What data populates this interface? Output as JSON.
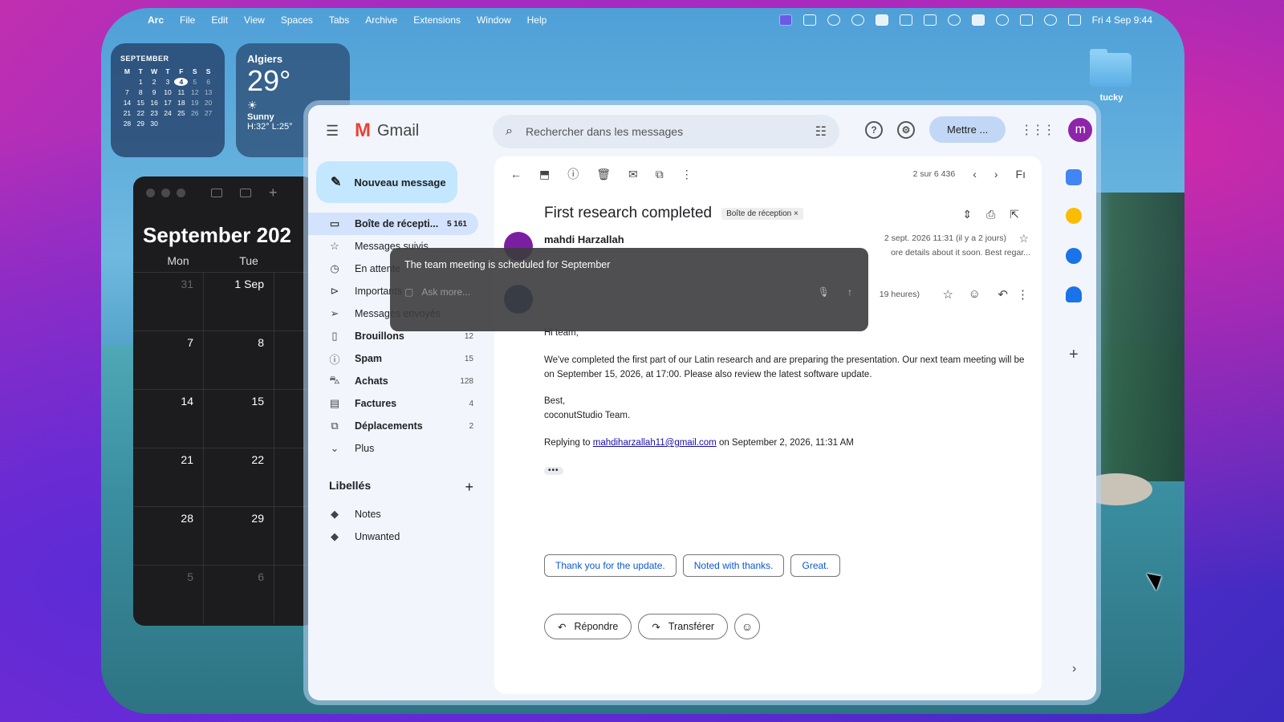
{
  "menubar": {
    "app_name": "Arc",
    "items": [
      "File",
      "Edit",
      "View",
      "Spaces",
      "Tabs",
      "Archive",
      "Extensions",
      "Window",
      "Help"
    ],
    "clock": "Fri 4 Sep  9:44"
  },
  "calendar_widget": {
    "month": "SEPTEMBER",
    "weekdays": [
      "M",
      "T",
      "W",
      "T",
      "F",
      "S",
      "S"
    ],
    "weeks": [
      [
        "",
        "1",
        "2",
        "3",
        "4",
        "5",
        "6"
      ],
      [
        "7",
        "8",
        "9",
        "10",
        "11",
        "12",
        "13"
      ],
      [
        "14",
        "15",
        "16",
        "17",
        "18",
        "19",
        "20"
      ],
      [
        "21",
        "22",
        "23",
        "24",
        "25",
        "26",
        "27"
      ],
      [
        "28",
        "29",
        "30",
        "",
        "",
        "",
        ""
      ]
    ],
    "today": "4"
  },
  "weather_widget": {
    "city": "Algiers",
    "temperature": "29°",
    "condition": "Sunny",
    "high_low": "H:32° L:25°",
    "icon": "sun-icon"
  },
  "calendar_app": {
    "title": "September 202",
    "day_headers": [
      "Mon",
      "Tue"
    ],
    "rows": [
      [
        "31",
        "1 Sep"
      ],
      [
        "7",
        "8"
      ],
      [
        "14",
        "15"
      ],
      [
        "21",
        "22"
      ],
      [
        "28",
        "29"
      ],
      [
        "5",
        "6"
      ]
    ]
  },
  "desktop": {
    "folder_label": "tucky"
  },
  "gmail": {
    "brand": "Gmail",
    "search_placeholder": "Rechercher dans les messages",
    "top_button": "Mettre ...",
    "avatar_letter": "m",
    "compose_label": "Nouveau message",
    "nav": [
      {
        "label": "Boîte de récepti...",
        "count": "5 161",
        "icon": "inbox-icon",
        "glyph": "▭",
        "active": true,
        "bold": true
      },
      {
        "label": "Messages suivis",
        "count": "",
        "icon": "star-icon",
        "glyph": "☆",
        "active": false,
        "bold": false
      },
      {
        "label": "En attente",
        "count": "",
        "icon": "clock-icon",
        "glyph": "◷",
        "active": false,
        "bold": false
      },
      {
        "label": "Importants",
        "count": "",
        "icon": "important-icon",
        "glyph": "⊳",
        "active": false,
        "bold": false
      },
      {
        "label": "Messages envoyés",
        "count": "",
        "icon": "send-icon",
        "glyph": "➢",
        "active": false,
        "bold": false
      },
      {
        "label": "Brouillons",
        "count": "12",
        "icon": "draft-icon",
        "glyph": "▯",
        "active": false,
        "bold": true
      },
      {
        "label": "Spam",
        "count": "15",
        "icon": "spam-icon",
        "glyph": "ⓘ",
        "active": false,
        "bold": true
      },
      {
        "label": "Achats",
        "count": "128",
        "icon": "shopping-icon",
        "glyph": "⛍",
        "active": false,
        "bold": true
      },
      {
        "label": "Factures",
        "count": "4",
        "icon": "receipt-icon",
        "glyph": "▤",
        "active": false,
        "bold": true
      },
      {
        "label": "Déplacements",
        "count": "2",
        "icon": "travel-icon",
        "glyph": "⧉",
        "active": false,
        "bold": true
      },
      {
        "label": "Plus",
        "count": "",
        "icon": "chevron-down-icon",
        "glyph": "⌄",
        "active": false,
        "bold": false
      }
    ],
    "labels_title": "Libellés",
    "labels": [
      {
        "label": "Notes",
        "icon": "label-icon"
      },
      {
        "label": "Unwanted",
        "icon": "label-icon"
      }
    ],
    "pager": "2 sur 6 436",
    "subject": "First research completed",
    "subject_tag": "Boîte de réception ×",
    "sender_name": "mahdi Harzallah",
    "sender_date": "2 sept. 2026 11:31 (il y a 2 jours)",
    "sender_snippet": "ore details about it soon. Best regar...",
    "reply_time": "19 heures)",
    "body": {
      "greeting": "Hi team,",
      "paragraph": "We've completed the first part of our Latin research and are preparing the presentation. Our next team meeting will be on September 15, 2026, at 17:00. Please also review the latest software update.",
      "sign_1": "Best,",
      "sign_2": "coconutStudio Team.",
      "reply_prefix": "Replying to ",
      "reply_email": "mahdiharzallah11@gmail.com",
      "reply_suffix": " on September 2, 2026, 11:31 AM"
    },
    "smart_replies": [
      "Thank you for the update.",
      "Noted with thanks.",
      "Great."
    ],
    "reply_label": "Répondre",
    "forward_label": "Transférer",
    "lang_label": "Fı"
  },
  "overlay": {
    "message": "The team meeting is scheduled for September",
    "placeholder": "Ask more..."
  }
}
